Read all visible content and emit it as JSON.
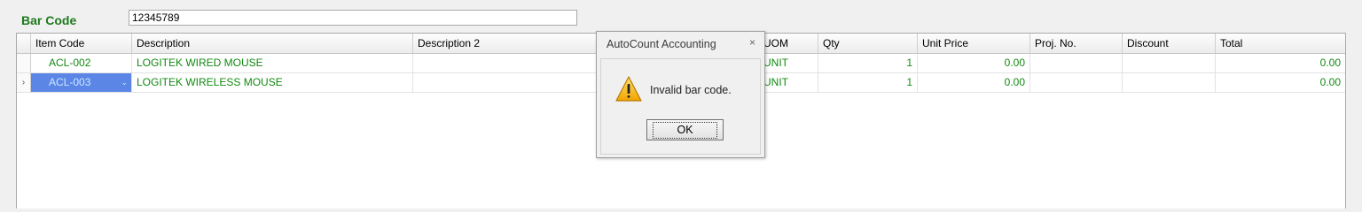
{
  "barcode": {
    "label": "Bar Code",
    "value": "12345789"
  },
  "grid": {
    "columns": [
      "Item Code",
      "Description",
      "Description 2",
      "UOM",
      "Qty",
      "Unit Price",
      "Proj. No.",
      "Discount",
      "Total"
    ],
    "rows": [
      {
        "indicator": "",
        "item_code": "ACL-002",
        "description": "LOGITEK WIRED MOUSE",
        "description2": "",
        "uom": "UNIT",
        "qty": "1",
        "unit_price": "0.00",
        "proj_no": "",
        "discount": "",
        "total": "0.00"
      },
      {
        "indicator": "›",
        "item_code": "ACL-003",
        "description": "LOGITEK WIRELESS MOUSE",
        "description2": "",
        "uom": "UNIT",
        "qty": "1",
        "unit_price": "0.00",
        "proj_no": "",
        "discount": "",
        "total": "0.00"
      }
    ]
  },
  "dialog": {
    "title": "AutoCount Accounting",
    "close": "×",
    "icon": "warning-icon",
    "message": "Invalid bar code.",
    "ok_label": "OK"
  },
  "colors": {
    "label_green": "#1e7a1e",
    "text_green": "#108a10",
    "selection": "#5b86e5"
  }
}
